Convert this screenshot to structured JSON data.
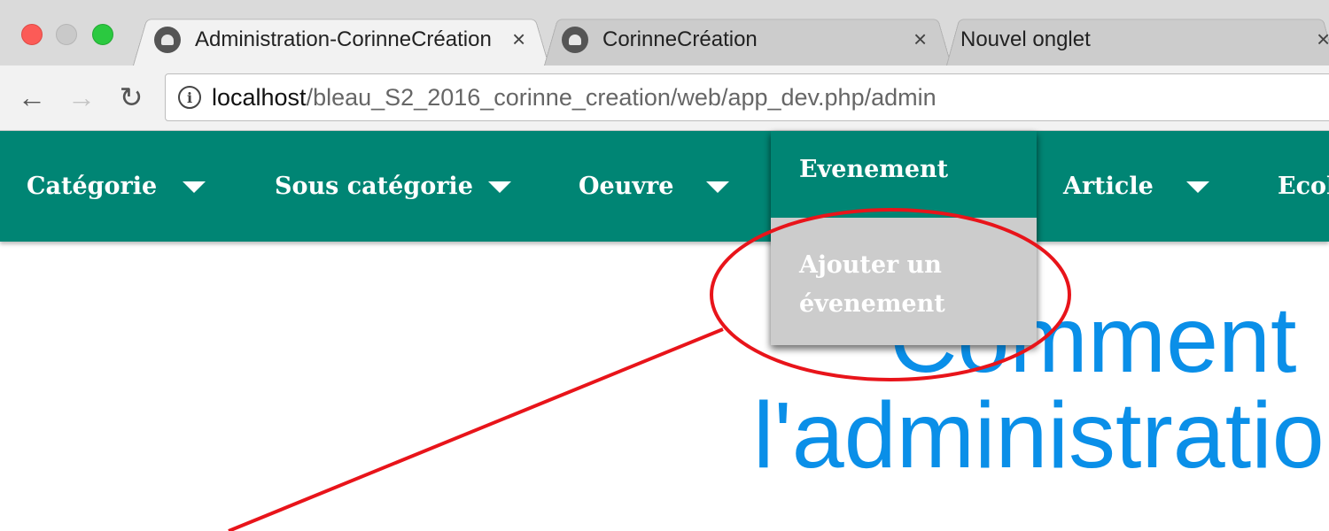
{
  "browser": {
    "tabs": [
      {
        "title": "Administration-CorinneCréation",
        "close": "×",
        "active": true
      },
      {
        "title": "CorinneCréation",
        "close": "×",
        "active": false
      },
      {
        "title": "Nouvel onglet",
        "close": "×",
        "active": false
      }
    ],
    "nav": {
      "back": "←",
      "forward": "→",
      "reload": "↻"
    },
    "omnibox": {
      "info": "i",
      "host": "localhost",
      "path": "/bleau_S2_2016_corinne_creation/web/app_dev.php/admin"
    }
  },
  "adminnav": {
    "items": [
      {
        "label": "Catégorie"
      },
      {
        "label": "Sous catégorie"
      },
      {
        "label": "Oeuvre"
      },
      {
        "label": "Evenement"
      },
      {
        "label": "Article"
      },
      {
        "label": "Ecole"
      }
    ],
    "dropdown": {
      "header": "Evenement",
      "item_line1": "Ajouter un",
      "item_line2": "évenement"
    }
  },
  "content": {
    "hero_line1": "Comment",
    "hero_line2": "l'administration"
  },
  "colors": {
    "nav_bg": "#008574",
    "dropdown_item_bg": "#cccccc",
    "hero_text": "#0a8fe8",
    "annotation": "#e8141a"
  }
}
